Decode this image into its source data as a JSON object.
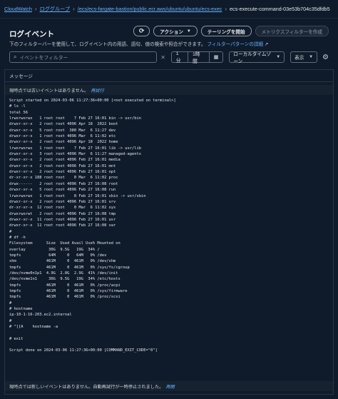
{
  "breadcrumb": {
    "items": [
      "CloudWatch",
      "ロググループ",
      "/ecs/ecs-fargate-bastion/public.ecr.aws/ubuntu/ubuntu/ecs-exec"
    ],
    "current": "ecs-execute-command-03e53b704c35dfdb5"
  },
  "header": {
    "title": "ログイベント",
    "description": "下のフィルターバーを使用して、ログイベント内の用語、語句、値の検索や照合ができます。",
    "pattern_link": "フィルターパターンの詳細"
  },
  "buttons": {
    "action": "アクション",
    "tail": "テーリングを開始",
    "metric_filter": "メトリクスフィルターを作成"
  },
  "filter": {
    "placeholder": "イベントをフィルター",
    "clear": "✕"
  },
  "time_range": [
    "1分",
    "1時間"
  ],
  "timezone": "ローカルタイムゾーン",
  "display": "表示",
  "column_header": "メッセージ",
  "notices": {
    "top": "現時点では古いイベントはありません。",
    "top_retry": "再試行",
    "bottom": "現時点では新しいイベントはありません。自動再試行が一時停止されました。",
    "bottom_resume": "再開"
  },
  "log_lines": [
    "Script started on 2024-03-06 11:27:36+00:00 [<not executed on terminal>]",
    "# ls -l",
    "total 56",
    "lrwxrwxrwx   1 root root    7 Feb 27 16:01 bin -> usr/bin",
    "drwxr-xr-x   2 root root 4096 Apr 18  2022 boot",
    "drwxr-xr-x   5 root root  380 Mar  6 11:27 dev",
    "drwxr-xr-x   1 root root 4096 Mar  6 11:02 etc",
    "drwxr-xr-x   2 root root 4096 Apr 18  2022 home",
    "lrwxrwxrwx   1 root root    7 Feb 27 16:01 lib -> usr/lib",
    "drwxr-xr-x   3 root root 4096 Mar  6 11:27 managed-agents",
    "drwxr-xr-x   2 root root 4096 Feb 27 16:01 media",
    "drwxr-xr-x   2 root root 4096 Feb 27 16:01 mnt",
    "drwxr-xr-x   2 root root 4096 Feb 27 16:01 opt",
    "dr-xr-xr-x 188 root root    0 Mar  6 11:02 proc",
    "drwx------   2 root root 4096 Feb 27 16:08 root",
    "drwxr-xr-x   5 root root 4096 Feb 27 16:08 run",
    "lrwxrwxrwx   1 root root    8 Feb 27 16:01 sbin -> usr/sbin",
    "drwxr-xr-x   2 root root 4096 Feb 27 16:01 srv",
    "dr-xr-xr-x  12 root root    0 Mar  6 11:02 sys",
    "drwxrwxrwt   2 root root 4096 Feb 27 16:08 tmp",
    "drwxr-xr-x  11 root root 4096 Feb 27 16:01 usr",
    "drwxr-xr-x  11 root root 4096 Feb 27 16:08 var",
    "#",
    "# df -h",
    "Filesystem      Size  Used Avail Use% Mounted on",
    "overlay          30G  9.5G   19G  34% /",
    "tmpfs            64M     0   64M   0% /dev",
    "shm             461M     0  461M   0% /dev/shm",
    "tmpfs           461M     0  461M   0% /sys/fs/cgroup",
    "/dev/nvme0n1p1  4.9G  2.0G  2.9G  41% /dev/init",
    "/dev/nvme1n1     30G  9.5G   19G  34% /etc/hosts",
    "tmpfs           461M     0  461M   0% /proc/acpi",
    "tmpfs           461M     0  461M   0% /sys/firmware",
    "tmpfs           461M     0  461M   0% /proc/scsi",
    "#",
    "# hostname",
    "ip-10-1-16-203.ec2.internal",
    "#",
    "# ^[[A    hostname -a",
    "",
    "# exit",
    "",
    "Script done on 2024-03-06 11:27:36+00:00 [COMMAND_EXIT_CODE=\"0\"]"
  ]
}
